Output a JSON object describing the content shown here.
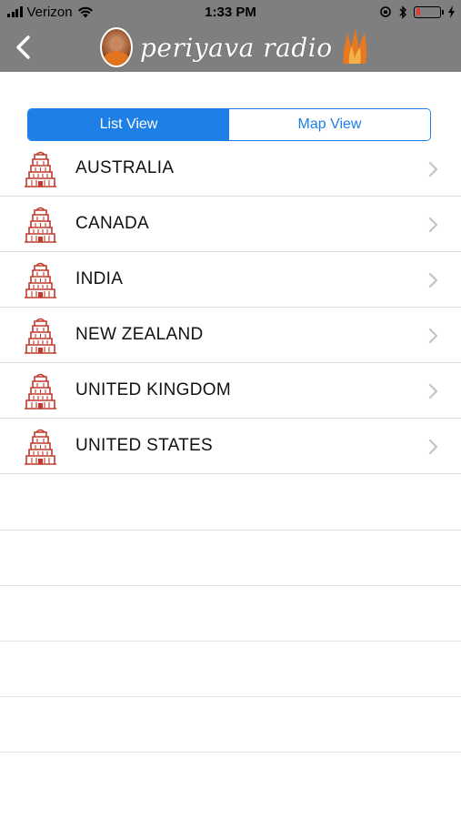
{
  "status_bar": {
    "carrier": "Verizon",
    "time": "1:33 PM"
  },
  "header": {
    "title": "periyava radio"
  },
  "segments": [
    {
      "label": "List View",
      "selected": true
    },
    {
      "label": "Map View",
      "selected": false
    }
  ],
  "countries": [
    {
      "name": "AUSTRALIA"
    },
    {
      "name": "CANADA"
    },
    {
      "name": "INDIA"
    },
    {
      "name": "NEW ZEALAND"
    },
    {
      "name": "UNITED KINGDOM"
    },
    {
      "name": "UNITED STATES"
    }
  ],
  "colors": {
    "accent": "#1e7fe6",
    "header_bg": "#7f7f7f",
    "temple_icon": "#c0392b"
  },
  "icons": {
    "row_icon": "temple-gopuram-icon",
    "row_accessory": "chevron-right-icon"
  }
}
